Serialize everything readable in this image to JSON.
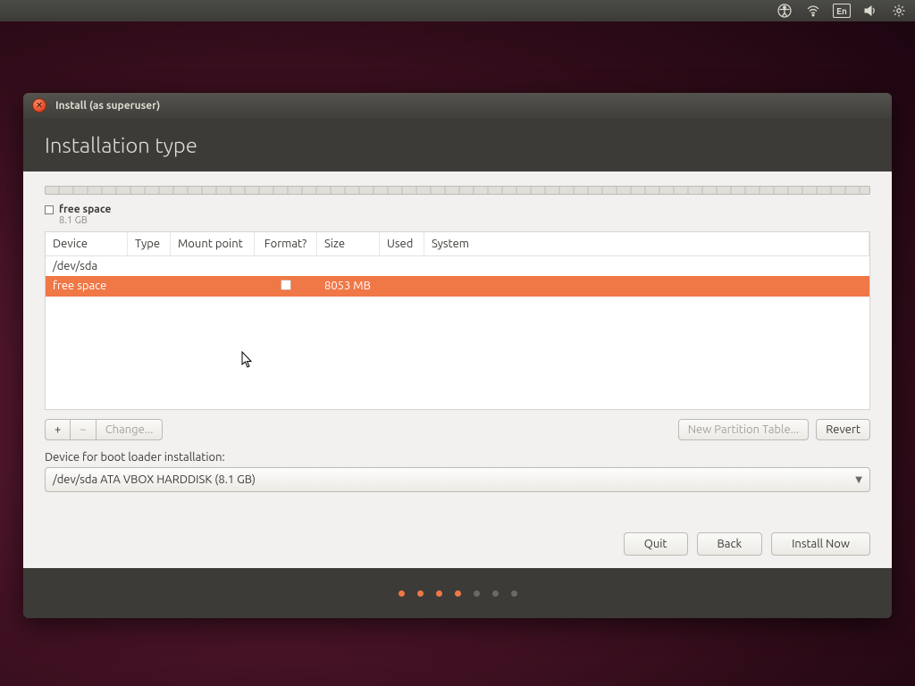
{
  "menubar": {
    "ime_label": "En"
  },
  "window": {
    "title": "Install (as superuser)",
    "header": "Installation type"
  },
  "usage": {
    "label": "free space",
    "sub": "8.1 GB"
  },
  "ptable": {
    "cols": {
      "device": "Device",
      "type": "Type",
      "mount": "Mount point",
      "format": "Format?",
      "size": "Size",
      "used": "Used",
      "system": "System"
    },
    "device_row": "/dev/sda",
    "rows": [
      {
        "device": "  free space",
        "type": "",
        "mount": "",
        "format_chk": true,
        "size": "8053 MB",
        "used": "",
        "system": "",
        "selected": true
      }
    ]
  },
  "toolbar": {
    "add": "+",
    "remove": "−",
    "change": "Change...",
    "new_table": "New Partition Table...",
    "revert": "Revert"
  },
  "bootloader": {
    "label": "Device for boot loader installation:",
    "value": "/dev/sda  ATA VBOX HARDDISK (8.1 GB)"
  },
  "footer": {
    "quit": "Quit",
    "back": "Back",
    "install": "Install Now"
  },
  "pager": {
    "total": 7,
    "active": 4
  }
}
